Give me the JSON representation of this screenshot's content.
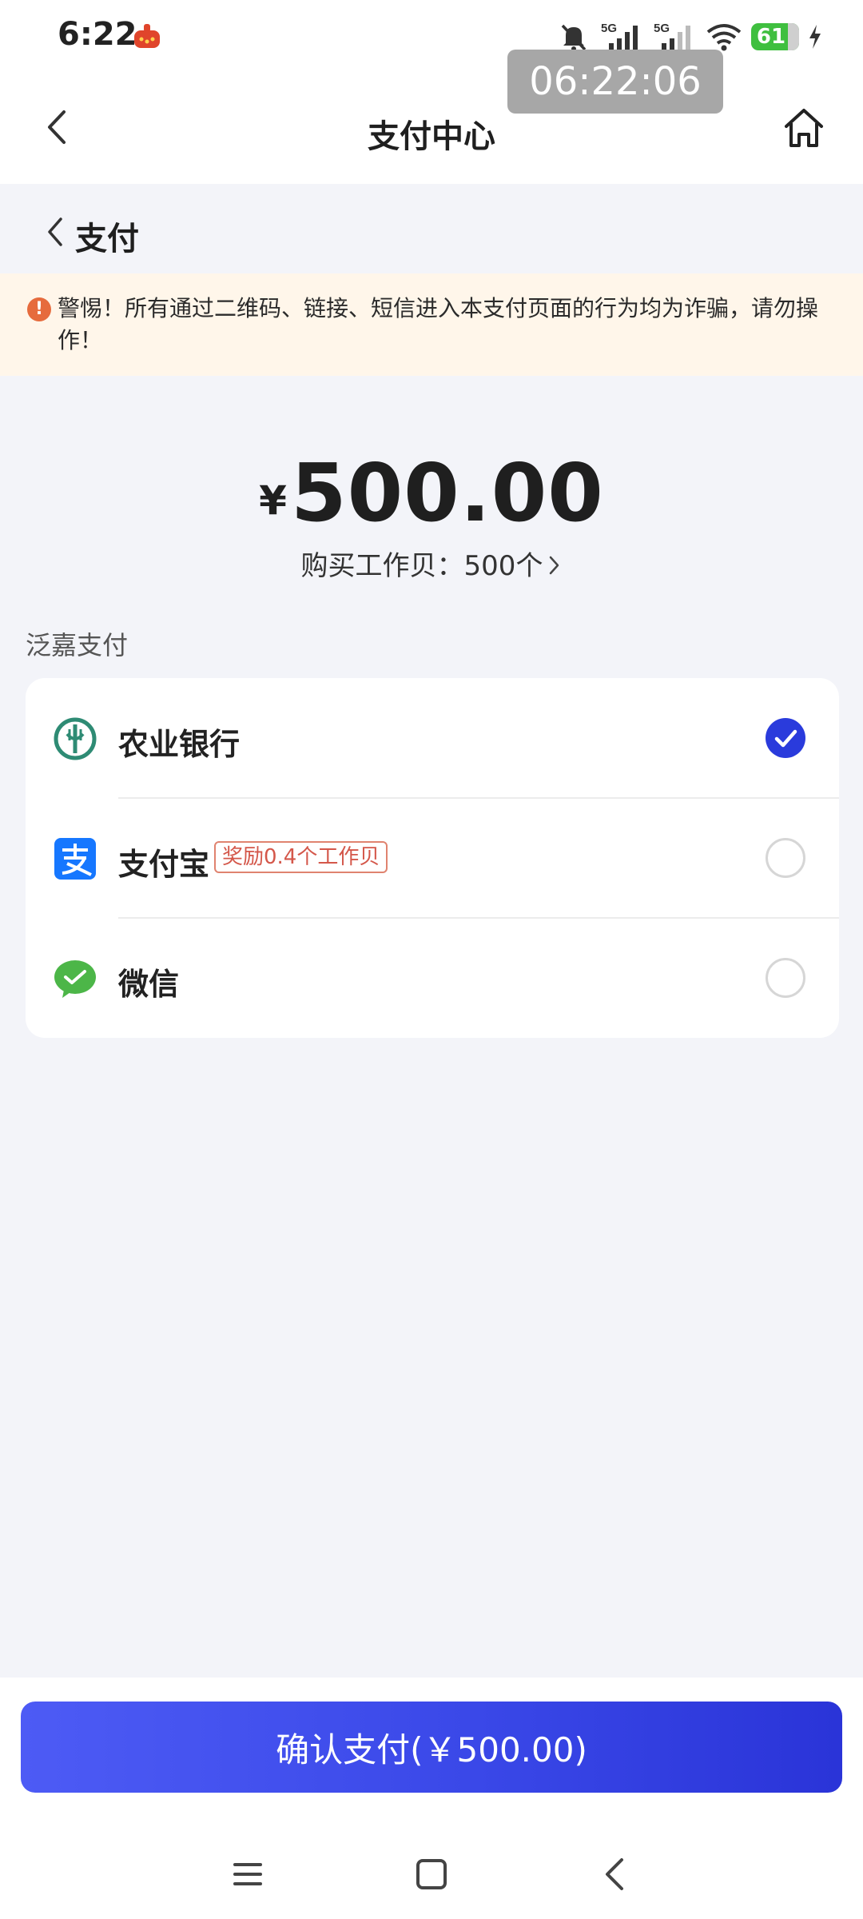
{
  "status_bar": {
    "time": "6:22",
    "battery_level": "61",
    "signal_1_label": "5G",
    "signal_2_label": "5G"
  },
  "time_overlay": "06:22:06",
  "header": {
    "title": "支付中心"
  },
  "sub_header": {
    "title": "支付"
  },
  "warning": {
    "icon": "!",
    "text": "警惕！所有通过二维码、链接、短信进入本支付页面的行为均为诈骗，请勿操作！"
  },
  "amount": {
    "symbol": "¥",
    "value": "500.00",
    "description": "购买工作贝：500个"
  },
  "payment_section": {
    "label": "泛嘉支付",
    "methods": [
      {
        "label": "农业银行",
        "selected": true,
        "icon": "abc-bank-icon",
        "color": "#2e8b74"
      },
      {
        "label": "支付宝",
        "badge": "奖励0.4个工作贝",
        "selected": false,
        "icon": "alipay-icon",
        "color": "#1677ff"
      },
      {
        "label": "微信",
        "selected": false,
        "icon": "wechat-icon",
        "color": "#4cb648"
      }
    ]
  },
  "confirm_button": {
    "label": "确认支付(￥500.00)"
  },
  "colors": {
    "accent": "#2a3bdc",
    "warning_bg": "#fff6ea",
    "warning_icon": "#e66b3d",
    "page_bg": "#f3f4f9"
  }
}
